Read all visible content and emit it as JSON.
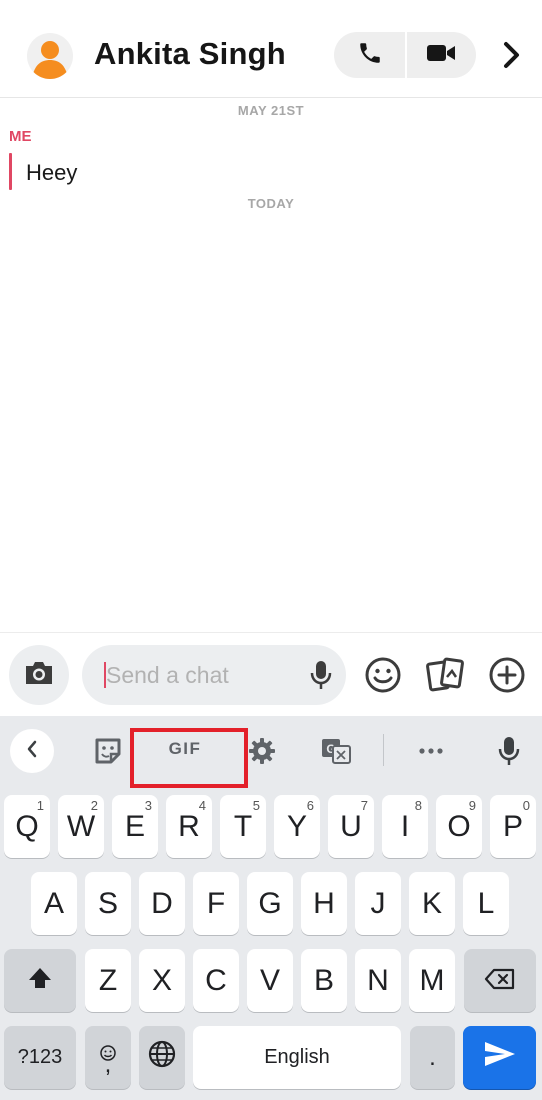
{
  "header": {
    "contact_name": "Ankita Singh",
    "avatar_icon": "user-avatar-icon",
    "call_icon": "phone-icon",
    "video_icon": "video-camera-icon",
    "more_icon": "chevron-right-icon"
  },
  "chat": {
    "date_earlier": "MAY 21ST",
    "sender_label": "ME",
    "message": "Heey",
    "date_today": "TODAY"
  },
  "input": {
    "placeholder": "Send a chat",
    "icons": [
      "camera-icon",
      "microphone-icon",
      "smiley-icon",
      "cards-icon",
      "plus-circle-icon"
    ]
  },
  "keyboard": {
    "toolbar": {
      "gif_label": "GIF",
      "icons": [
        "back-chevron-icon",
        "sticker-icon",
        "gif-icon",
        "settings-gear-icon",
        "translate-icon",
        "more-dots-icon",
        "voice-mic-icon"
      ]
    },
    "row1": [
      {
        "label": "Q",
        "hint": "1"
      },
      {
        "label": "W",
        "hint": "2"
      },
      {
        "label": "E",
        "hint": "3"
      },
      {
        "label": "R",
        "hint": "4"
      },
      {
        "label": "T",
        "hint": "5"
      },
      {
        "label": "Y",
        "hint": "6"
      },
      {
        "label": "U",
        "hint": "7"
      },
      {
        "label": "I",
        "hint": "8"
      },
      {
        "label": "O",
        "hint": "9"
      },
      {
        "label": "P",
        "hint": "0"
      }
    ],
    "row2": [
      "A",
      "S",
      "D",
      "F",
      "G",
      "H",
      "J",
      "K",
      "L"
    ],
    "row3": [
      "Z",
      "X",
      "C",
      "V",
      "B",
      "N",
      "M"
    ],
    "symbols_label": "?123",
    "comma_label": ",",
    "space_label": "English",
    "period_label": ".",
    "colors": {
      "accent_red": "#e04763",
      "highlight_box": "#e3202a",
      "enter_blue": "#1a73e8",
      "avatar_orange": "#f58d1f"
    }
  }
}
